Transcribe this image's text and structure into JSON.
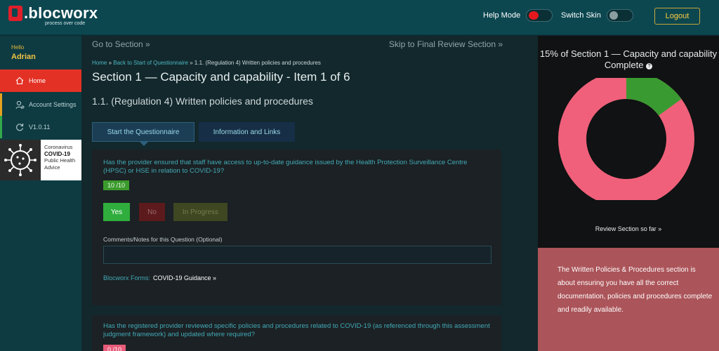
{
  "header": {
    "logo_text": ".blocworx",
    "logo_tagline": "process over code",
    "help_mode_label": "Help Mode",
    "switch_skin_label": "Switch Skin",
    "logout_label": "Logout"
  },
  "sidebar": {
    "greeting": "Hello",
    "user_name": "Adrian",
    "items": [
      {
        "label": "Home",
        "icon": "home-icon"
      },
      {
        "label": "Account Settings",
        "icon": "user-gear-icon"
      },
      {
        "label": "V1.0.11",
        "icon": "refresh-icon"
      }
    ],
    "covid_banner": {
      "line1": "Coronavirus",
      "line2": "COVID-19",
      "line3": "Public Health",
      "line4": "Advice"
    }
  },
  "main": {
    "go_to_section": "Go to Section »",
    "skip_to_final": "Skip to Final Review Section »",
    "breadcrumb": {
      "home": "Home",
      "sep": " » ",
      "back": "Back to Start of Questionnaire",
      "current": "1.1. (Regulation 4) Written policies and procedures"
    },
    "section_title": "Section 1 — Capacity and capability - Item 1 of 6",
    "item_title": "1.1. (Regulation 4) Written policies and procedures",
    "tabs": [
      {
        "label": "Start the Questionnaire",
        "active": true
      },
      {
        "label": "Information and Links",
        "active": false
      }
    ],
    "questions": [
      {
        "text": "Has the provider ensured that staff have access to up-to-date guidance issued by the Health Protection Surveillance Centre (HPSC) or HSE in relation to COVID-19?",
        "score": "10 /10",
        "answers": [
          "Yes",
          "No",
          "In Progress"
        ],
        "selected": "Yes",
        "comments_label": "Comments/Notes for this Question (Optional)",
        "comments_value": "",
        "forms_label": "Blocworx Forms:",
        "forms_link": "COVID-19 Guidance »"
      },
      {
        "text": "Has the registered provider reviewed specific policies and procedures related to COVID-19 (as referenced through this assessment judgment framework) and updated where required?",
        "score": "0 /10"
      }
    ]
  },
  "progress_panel": {
    "title": "15% of Section 1 — Capacity and capability Complete",
    "percent_complete": 15,
    "complete_color": "#3a9a32",
    "remaining_color": "#f0607a",
    "review_link": "Review Section so far »",
    "info_text": "The Written Policies & Procedures section is about ensuring you have all the correct documentation, policies and procedures complete and readily available."
  },
  "colors": {
    "topbar": "#0c4750",
    "home_active": "#e33225",
    "accent_gold": "#ffcf40",
    "question_teal": "#43aab7",
    "info_panel": "#ab5459"
  }
}
